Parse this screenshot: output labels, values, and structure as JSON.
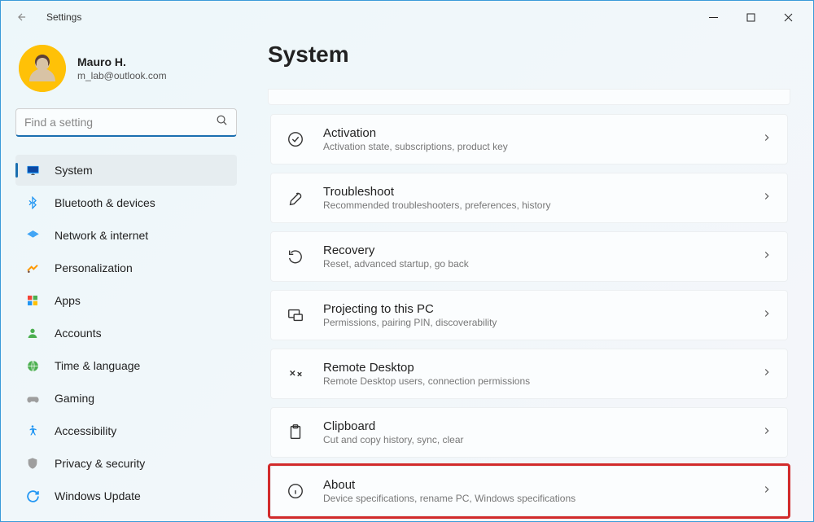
{
  "window": {
    "title": "Settings"
  },
  "profile": {
    "name": "Mauro H.",
    "email": "m_lab@outlook.com"
  },
  "search": {
    "placeholder": "Find a setting"
  },
  "nav": {
    "items": [
      {
        "label": "System",
        "selected": true
      },
      {
        "label": "Bluetooth & devices"
      },
      {
        "label": "Network & internet"
      },
      {
        "label": "Personalization"
      },
      {
        "label": "Apps"
      },
      {
        "label": "Accounts"
      },
      {
        "label": "Time & language"
      },
      {
        "label": "Gaming"
      },
      {
        "label": "Accessibility"
      },
      {
        "label": "Privacy & security"
      },
      {
        "label": "Windows Update"
      }
    ]
  },
  "main": {
    "title": "System",
    "items": [
      {
        "title": "Activation",
        "desc": "Activation state, subscriptions, product key"
      },
      {
        "title": "Troubleshoot",
        "desc": "Recommended troubleshooters, preferences, history"
      },
      {
        "title": "Recovery",
        "desc": "Reset, advanced startup, go back"
      },
      {
        "title": "Projecting to this PC",
        "desc": "Permissions, pairing PIN, discoverability"
      },
      {
        "title": "Remote Desktop",
        "desc": "Remote Desktop users, connection permissions"
      },
      {
        "title": "Clipboard",
        "desc": "Cut and copy history, sync, clear"
      },
      {
        "title": "About",
        "desc": "Device specifications, rename PC, Windows specifications",
        "highlighted": true
      }
    ]
  }
}
